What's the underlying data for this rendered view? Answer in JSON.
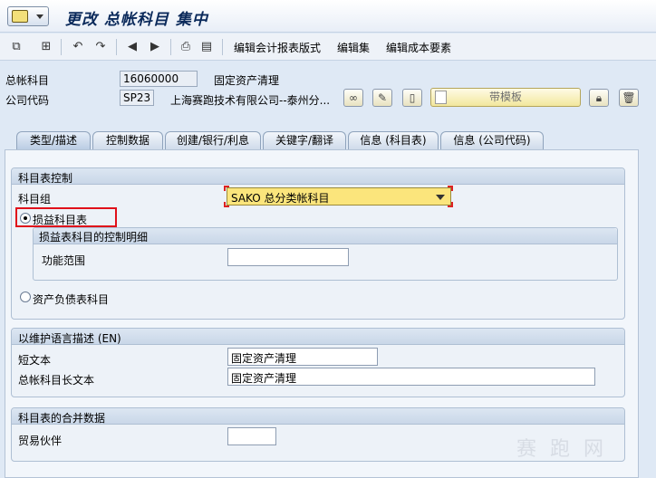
{
  "title": "更改 总帐科目 集中",
  "toolbar": {
    "items": [
      "编辑会计报表版式",
      "编辑集",
      "编辑成本要素"
    ]
  },
  "header": {
    "gl_account_label": "总帐科目",
    "gl_account_value": "16060000",
    "gl_account_desc": "固定资产清理",
    "company_code_label": "公司代码",
    "company_code_value": "SP23",
    "company_name": "上海赛跑技术有限公司--泰州分...",
    "template_button": "带模板"
  },
  "tabs": [
    "类型/描述",
    "控制数据",
    "创建/银行/利息",
    "关键字/翻译",
    "信息 (科目表)",
    "信息 (公司代码)"
  ],
  "sections": {
    "coa_control": {
      "title": "科目表控制",
      "account_group_label": "科目组",
      "account_group_value": "SAKO 总分类帐科目",
      "pl_account_label": "损益科目表",
      "pl_detail_title": "损益表科目的控制明细",
      "functional_area_label": "功能范围",
      "functional_area_value": "",
      "bs_account_label": "资产负债表科目"
    },
    "description": {
      "title": "以维护语言描述 (EN)",
      "short_text_label": "短文本",
      "short_text_value": "固定资产清理",
      "long_text_label": "总帐科目长文本",
      "long_text_value": "固定资产清理"
    },
    "consolidation": {
      "title": "科目表的合并数据",
      "trading_partner_label": "贸易伙伴",
      "trading_partner_value": ""
    }
  },
  "watermark": "赛 跑 网"
}
